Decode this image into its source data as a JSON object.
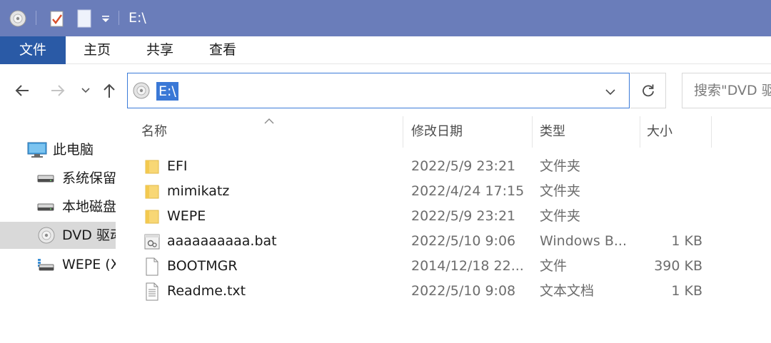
{
  "window": {
    "title": "E:\\"
  },
  "ribbon": {
    "tabs": [
      "文件",
      "主页",
      "共享",
      "查看"
    ]
  },
  "address": {
    "path": "E:\\"
  },
  "search": {
    "placeholder": "搜索\"DVD 驱"
  },
  "navpane": {
    "items": [
      {
        "label": "此电脑",
        "icon": "computer-icon"
      },
      {
        "label": "系统保留",
        "icon": "drive-icon"
      },
      {
        "label": "本地磁盘",
        "icon": "drive-icon"
      },
      {
        "label": "DVD 驱动",
        "icon": "dvd-drive-icon",
        "selected": true
      },
      {
        "label": "WEPE (X",
        "icon": "network-drive-icon"
      }
    ]
  },
  "columns": {
    "name": "名称",
    "date": "修改日期",
    "type": "类型",
    "size": "大小"
  },
  "files": [
    {
      "name": "EFI",
      "date": "2022/5/9 23:21",
      "type": "文件夹",
      "size": "",
      "icon": "folder-icon"
    },
    {
      "name": "mimikatz",
      "date": "2022/4/24 17:15",
      "type": "文件夹",
      "size": "",
      "icon": "folder-icon"
    },
    {
      "name": "WEPE",
      "date": "2022/5/9 23:21",
      "type": "文件夹",
      "size": "",
      "icon": "folder-icon"
    },
    {
      "name": "aaaaaaaaaa.bat",
      "date": "2022/5/10 9:06",
      "type": "Windows B...",
      "size": "1 KB",
      "icon": "batch-file-icon"
    },
    {
      "name": "BOOTMGR",
      "date": "2014/12/18 22...",
      "type": "文件",
      "size": "390 KB",
      "icon": "file-icon"
    },
    {
      "name": "Readme.txt",
      "date": "2022/5/10 9:08",
      "type": "文本文档",
      "size": "1 KB",
      "icon": "text-file-icon"
    }
  ],
  "colors": {
    "titlebar": "#6a7dba",
    "file_tab": "#2a5aa6",
    "selection": "#3a78d6",
    "folder": "#f8d775"
  }
}
